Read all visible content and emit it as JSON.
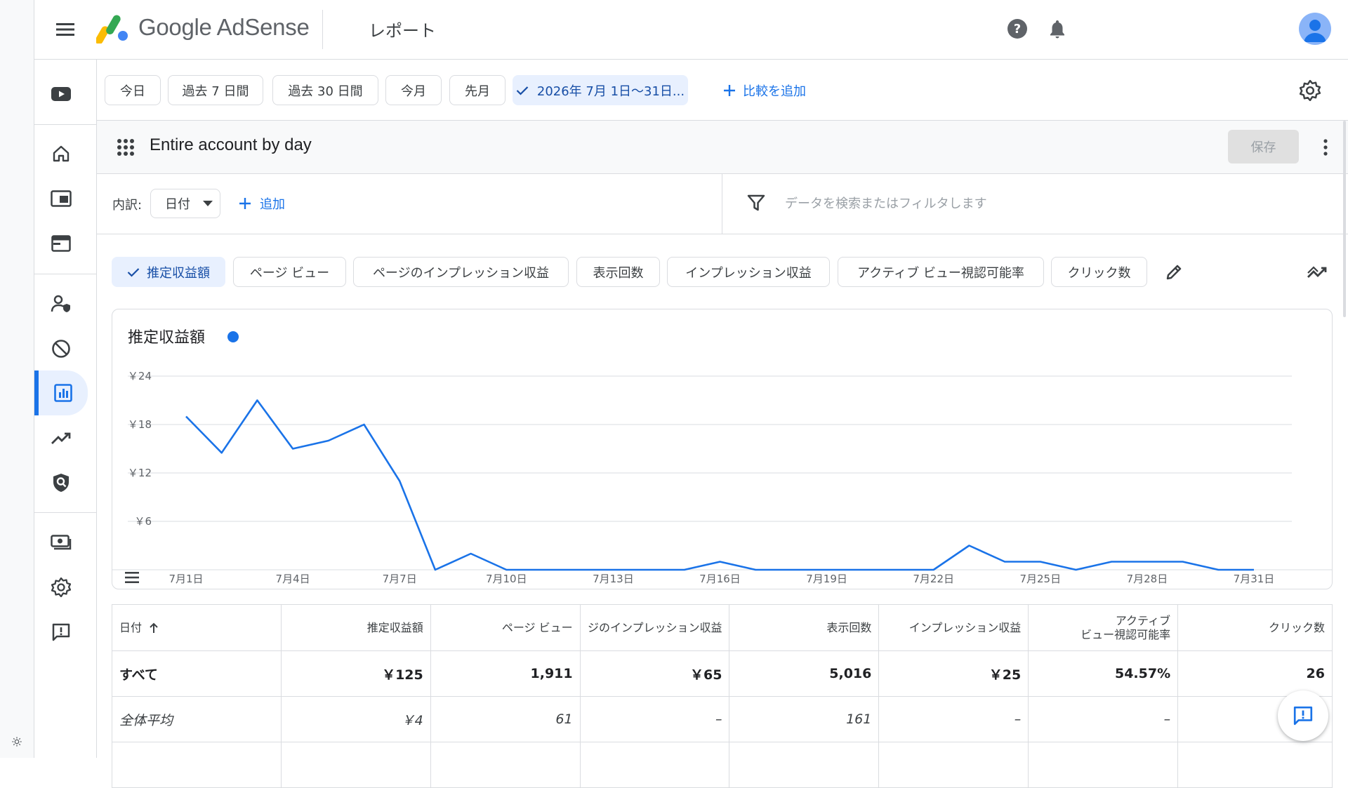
{
  "header": {
    "brand": "Google AdSense",
    "page_title": "レポート"
  },
  "toolbar": {
    "date_chips": [
      {
        "label": "今日"
      },
      {
        "label": "過去 7 日間"
      },
      {
        "label": "過去 30 日間"
      },
      {
        "label": "今月"
      },
      {
        "label": "先月"
      },
      {
        "label": "2026年 7月 1日～31日...",
        "selected": true
      }
    ],
    "compare_label": "比較を追加"
  },
  "report": {
    "name": "Entire account by day",
    "save_label": "保存"
  },
  "breakdown": {
    "label": "内訳:",
    "selected": "日付",
    "add_label": "追加",
    "search_placeholder": "データを検索またはフィルタします"
  },
  "metric_chips": [
    {
      "label": "推定収益額",
      "selected": true
    },
    {
      "label": "ページ ビュー"
    },
    {
      "label": "ページのインプレッション収益"
    },
    {
      "label": "表示回数"
    },
    {
      "label": "インプレッション収益"
    },
    {
      "label": "アクティブ ビュー視認可能率"
    },
    {
      "label": "クリック数"
    }
  ],
  "colors": {
    "accent": "#1a73e8",
    "selected_bg": "#e8f0fe"
  },
  "chart_data": {
    "type": "line",
    "title": "推定収益額",
    "series_color": "#1a73e8",
    "x_labels": [
      "7月1日",
      "7月4日",
      "7月7日",
      "7月10日",
      "7月13日",
      "7月16日",
      "7月19日",
      "7月22日",
      "7月25日",
      "7月28日",
      "7月31日"
    ],
    "y_ticks": [
      "￥24",
      "￥18",
      "￥12",
      "￥6"
    ],
    "y_tick_values": [
      24,
      18,
      12,
      6
    ],
    "ylim": [
      0,
      24
    ],
    "grid": true,
    "series": [
      {
        "values": [
          19,
          14.5,
          21,
          15,
          16,
          18,
          11,
          0,
          2,
          0,
          0,
          0,
          0,
          0,
          0,
          1,
          0,
          0,
          0,
          0,
          0,
          0,
          3,
          1,
          1,
          0,
          1,
          1,
          1,
          0,
          0
        ]
      }
    ]
  },
  "table": {
    "columns": [
      "日付",
      "推定収益額",
      "ページ ビュー",
      "ジのインプレッション収益",
      "表示回数",
      "インプレッション収益",
      "アクティブ\nビュー視認可能率",
      "クリック数"
    ],
    "rows": [
      {
        "kind": "total",
        "cells": [
          "すべて",
          "￥125",
          "1,911",
          "￥65",
          "5,016",
          "￥25",
          "54.57%",
          "26"
        ]
      },
      {
        "kind": "avg",
        "cells": [
          "全体平均",
          "￥4",
          "61",
          "–",
          "161",
          "–",
          "–",
          ""
        ]
      }
    ]
  }
}
